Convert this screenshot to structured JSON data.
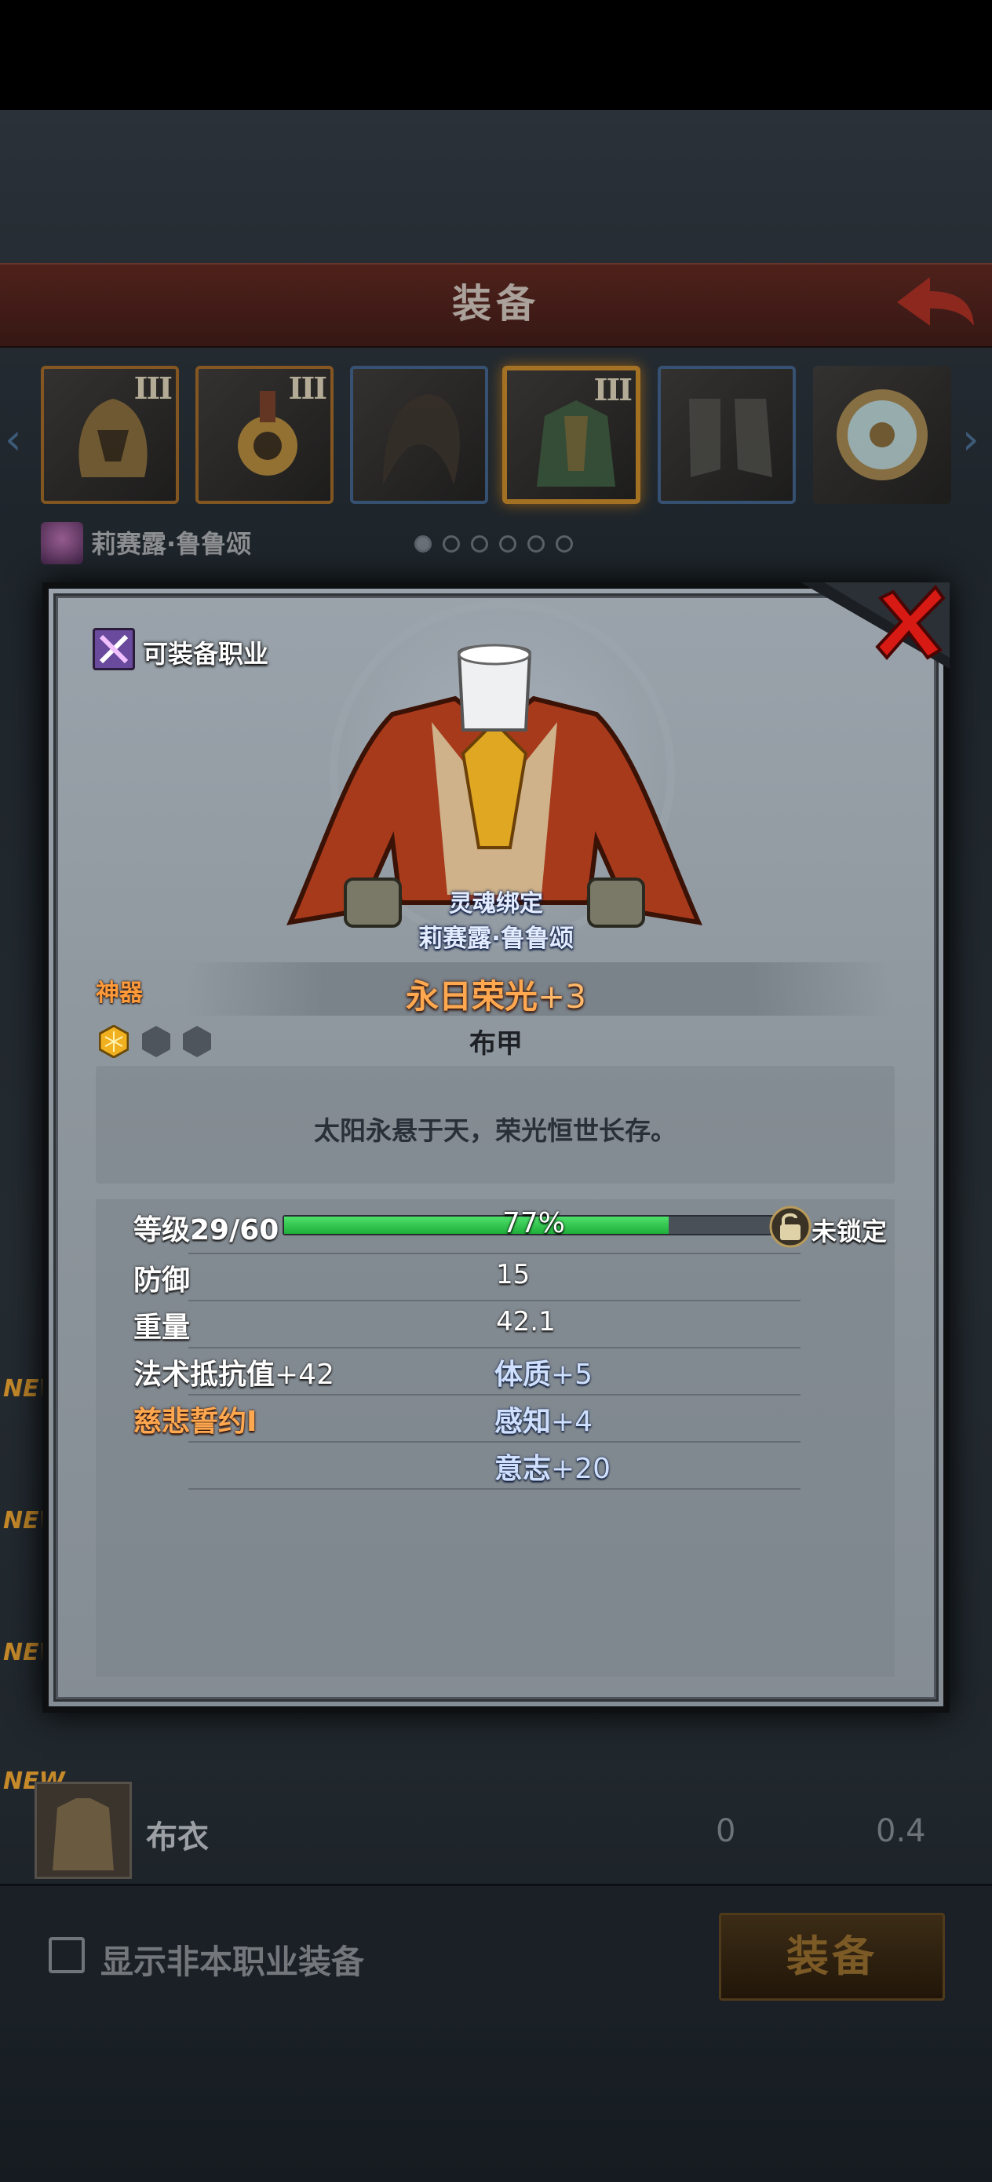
{
  "header": {
    "title": "装备"
  },
  "equip_slots": [
    {
      "tier": "III",
      "border": "gold",
      "icon": "helmet-icon"
    },
    {
      "tier": "III",
      "border": "gold",
      "icon": "amulet-icon"
    },
    {
      "tier": "",
      "border": "blue",
      "icon": "hood-icon"
    },
    {
      "tier": "III",
      "border": "selected",
      "icon": "armor-icon"
    },
    {
      "tier": "",
      "border": "blue",
      "icon": "boots-icon"
    },
    {
      "tier": "",
      "border": "none",
      "icon": "ring-icon"
    }
  ],
  "character": {
    "name": "莉赛露·鲁鲁颂",
    "page_count": 6,
    "page_index": 0
  },
  "list": {
    "new_tags": [
      "NEW",
      "NEW",
      "NEW",
      "NEW"
    ],
    "last_item": {
      "name": "布衣",
      "value1": "0",
      "value2": "0.4"
    }
  },
  "bottom": {
    "show_other_label": "显示非本职业装备",
    "equip_button": "装备"
  },
  "dialog": {
    "class_label": "可装备职业",
    "soul_bound": "灵魂绑定",
    "owner": "莉赛露·鲁鲁颂",
    "rarity": "神器",
    "item_name": "永日荣光",
    "enhance": "+3",
    "item_type": "布甲",
    "description": "太阳永悬于天，荣光恒世长存。",
    "level": {
      "label": "等级29/60",
      "progress_pct": 77,
      "progress_text": "77%",
      "lock_label": "未锁定"
    },
    "stats": [
      {
        "label": "防御",
        "value": "15"
      },
      {
        "label": "重量",
        "value": "42.1"
      }
    ],
    "bonuses_left": [
      {
        "name": "法术抵抗值",
        "value": "+42",
        "color": "#ffffff"
      },
      {
        "name": "慈悲誓约Ⅰ",
        "value": "",
        "color": "#ffa850"
      }
    ],
    "bonuses_right": [
      {
        "name": "体质",
        "value": "+5"
      },
      {
        "name": "感知",
        "value": "+4"
      },
      {
        "name": "意志",
        "value": "+20"
      }
    ]
  },
  "colors": {
    "accent_orange": "#ffa850",
    "progress_green": "#2fc04a",
    "close_red": "#d81a14"
  }
}
